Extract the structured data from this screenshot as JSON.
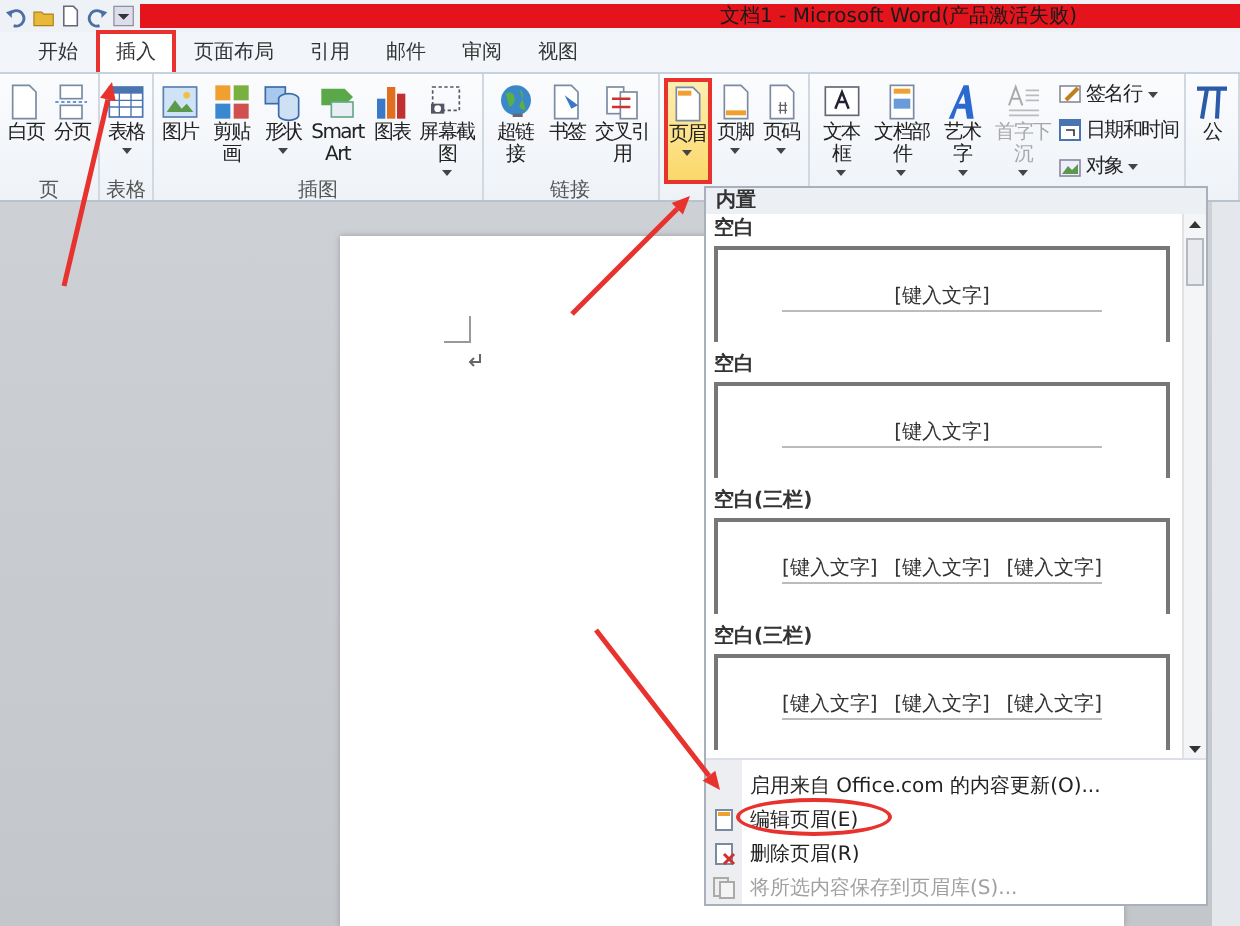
{
  "window": {
    "title": "文档1 - Microsoft Word(产品激活失败)"
  },
  "tabs": [
    {
      "label": "开始",
      "selected": false,
      "annotated": false
    },
    {
      "label": "插入",
      "selected": true,
      "annotated": true
    },
    {
      "label": "页面布局",
      "selected": false,
      "annotated": false
    },
    {
      "label": "引用",
      "selected": false,
      "annotated": false
    },
    {
      "label": "邮件",
      "selected": false,
      "annotated": false
    },
    {
      "label": "审阅",
      "selected": false,
      "annotated": false
    },
    {
      "label": "视图",
      "selected": false,
      "annotated": false
    }
  ],
  "ribbon": {
    "groups": [
      {
        "label": "页",
        "buttons": [
          {
            "label": "白页",
            "kind": "large",
            "dropdown": false,
            "disabled": false,
            "selected": false,
            "annotated": false
          },
          {
            "label": "分页",
            "kind": "large",
            "dropdown": false,
            "disabled": false,
            "selected": false,
            "annotated": false
          }
        ]
      },
      {
        "label": "表格",
        "buttons": [
          {
            "label": "表格",
            "kind": "large",
            "dropdown": true,
            "disabled": false,
            "selected": false,
            "annotated": false
          }
        ]
      },
      {
        "label": "插图",
        "buttons": [
          {
            "label": "图片",
            "kind": "large",
            "dropdown": false,
            "disabled": false,
            "selected": false,
            "annotated": false
          },
          {
            "label": "剪贴画",
            "kind": "large",
            "dropdown": false,
            "disabled": false,
            "selected": false,
            "annotated": false
          },
          {
            "label": "形状",
            "kind": "large",
            "dropdown": true,
            "disabled": false,
            "selected": false,
            "annotated": false
          },
          {
            "label": "SmartArt",
            "kind": "large",
            "dropdown": false,
            "disabled": false,
            "selected": false,
            "annotated": false
          },
          {
            "label": "图表",
            "kind": "large",
            "dropdown": false,
            "disabled": false,
            "selected": false,
            "annotated": false
          },
          {
            "label": "屏幕截图",
            "kind": "large",
            "dropdown": true,
            "disabled": false,
            "selected": false,
            "annotated": false
          }
        ]
      },
      {
        "label": "链接",
        "buttons": [
          {
            "label": "超链接",
            "kind": "large",
            "dropdown": false,
            "disabled": false,
            "selected": false,
            "annotated": false
          },
          {
            "label": "书签",
            "kind": "large",
            "dropdown": false,
            "disabled": false,
            "selected": false,
            "annotated": false
          },
          {
            "label": "交叉引用",
            "kind": "large",
            "dropdown": false,
            "disabled": false,
            "selected": false,
            "annotated": false
          }
        ]
      },
      {
        "buttons": [
          {
            "label": "页眉",
            "kind": "large",
            "dropdown": true,
            "disabled": false,
            "selected": true,
            "annotated": true
          },
          {
            "label": "页脚",
            "kind": "large",
            "dropdown": true,
            "disabled": false,
            "selected": false,
            "annotated": false
          },
          {
            "label": "页码",
            "kind": "large",
            "dropdown": true,
            "disabled": false,
            "selected": false,
            "annotated": false
          }
        ]
      },
      {
        "buttons": [
          {
            "label": "文本框",
            "kind": "large",
            "dropdown": true,
            "disabled": false,
            "selected": false,
            "annotated": false
          },
          {
            "label": "文档部件",
            "kind": "large",
            "dropdown": true,
            "disabled": false,
            "selected": false,
            "annotated": false
          },
          {
            "label": "艺术字",
            "kind": "large",
            "dropdown": true,
            "disabled": false,
            "selected": false,
            "annotated": false
          },
          {
            "label": "首字下沉",
            "kind": "large",
            "dropdown": true,
            "disabled": true,
            "selected": false,
            "annotated": false
          },
          {
            "label": "签名行",
            "kind": "small",
            "dropdown": true,
            "disabled": false,
            "selected": false,
            "annotated": false
          },
          {
            "label": "日期和时间",
            "kind": "small",
            "dropdown": false,
            "disabled": false,
            "selected": false,
            "annotated": false
          },
          {
            "label": "对象",
            "kind": "small",
            "dropdown": true,
            "disabled": false,
            "selected": false,
            "annotated": false
          }
        ]
      },
      {
        "buttons": [
          {
            "label": "公",
            "kind": "large",
            "dropdown": false,
            "disabled": false,
            "selected": false,
            "annotated": false
          }
        ]
      }
    ]
  },
  "gallery": {
    "header": "内置",
    "items": [
      {
        "title": "空白",
        "placeholders": [
          "[键入文字]"
        ]
      },
      {
        "title": "空白",
        "placeholders": [
          "[键入文字]"
        ]
      },
      {
        "title": "空白(三栏)",
        "placeholders": [
          "[键入文字]",
          "[键入文字]",
          "[键入文字]"
        ]
      },
      {
        "title": "空白(三栏)",
        "placeholders": [
          "[键入文字]",
          "[键入文字]",
          "[键入文字]"
        ]
      }
    ]
  },
  "menu": [
    {
      "label": "启用来自 Office.com 的内容更新(O)...",
      "disabled": false,
      "annotated": false
    },
    {
      "label": "编辑页眉(E)",
      "disabled": false,
      "annotated": true
    },
    {
      "label": "删除页眉(R)",
      "disabled": false,
      "annotated": false
    },
    {
      "label": "将所选内容保存到页眉库(S)...",
      "disabled": true,
      "annotated": false
    }
  ]
}
